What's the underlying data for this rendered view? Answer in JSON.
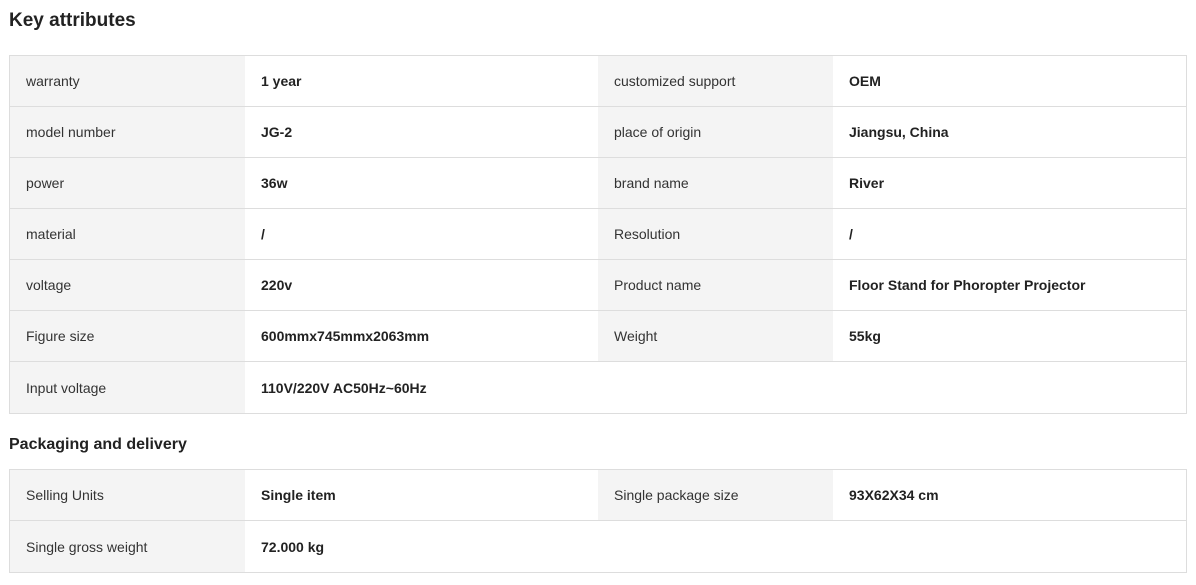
{
  "key_attributes": {
    "title": "Key attributes",
    "rows": [
      [
        {
          "k": "warranty",
          "v": "1 year"
        },
        {
          "k": "customized support",
          "v": "OEM"
        }
      ],
      [
        {
          "k": "model number",
          "v": "JG-2"
        },
        {
          "k": "place of origin",
          "v": "Jiangsu, China"
        }
      ],
      [
        {
          "k": "power",
          "v": "36w"
        },
        {
          "k": "brand name",
          "v": "River"
        }
      ],
      [
        {
          "k": "material",
          "v": "/"
        },
        {
          "k": "Resolution",
          "v": "/"
        }
      ],
      [
        {
          "k": "voltage",
          "v": "220v"
        },
        {
          "k": "Product name",
          "v": "Floor Stand for Phoropter Projector"
        }
      ],
      [
        {
          "k": "Figure size",
          "v": "600mmx745mmx2063mm"
        },
        {
          "k": "Weight",
          "v": "55kg"
        }
      ],
      [
        {
          "k": "Input voltage",
          "v": "110V/220V AC50Hz~60Hz"
        }
      ]
    ]
  },
  "packaging": {
    "title": "Packaging and delivery",
    "rows": [
      [
        {
          "k": "Selling Units",
          "v": "Single item"
        },
        {
          "k": "Single package size",
          "v": "93X62X34 cm"
        }
      ],
      [
        {
          "k": "Single gross weight",
          "v": "72.000 kg"
        }
      ]
    ]
  }
}
